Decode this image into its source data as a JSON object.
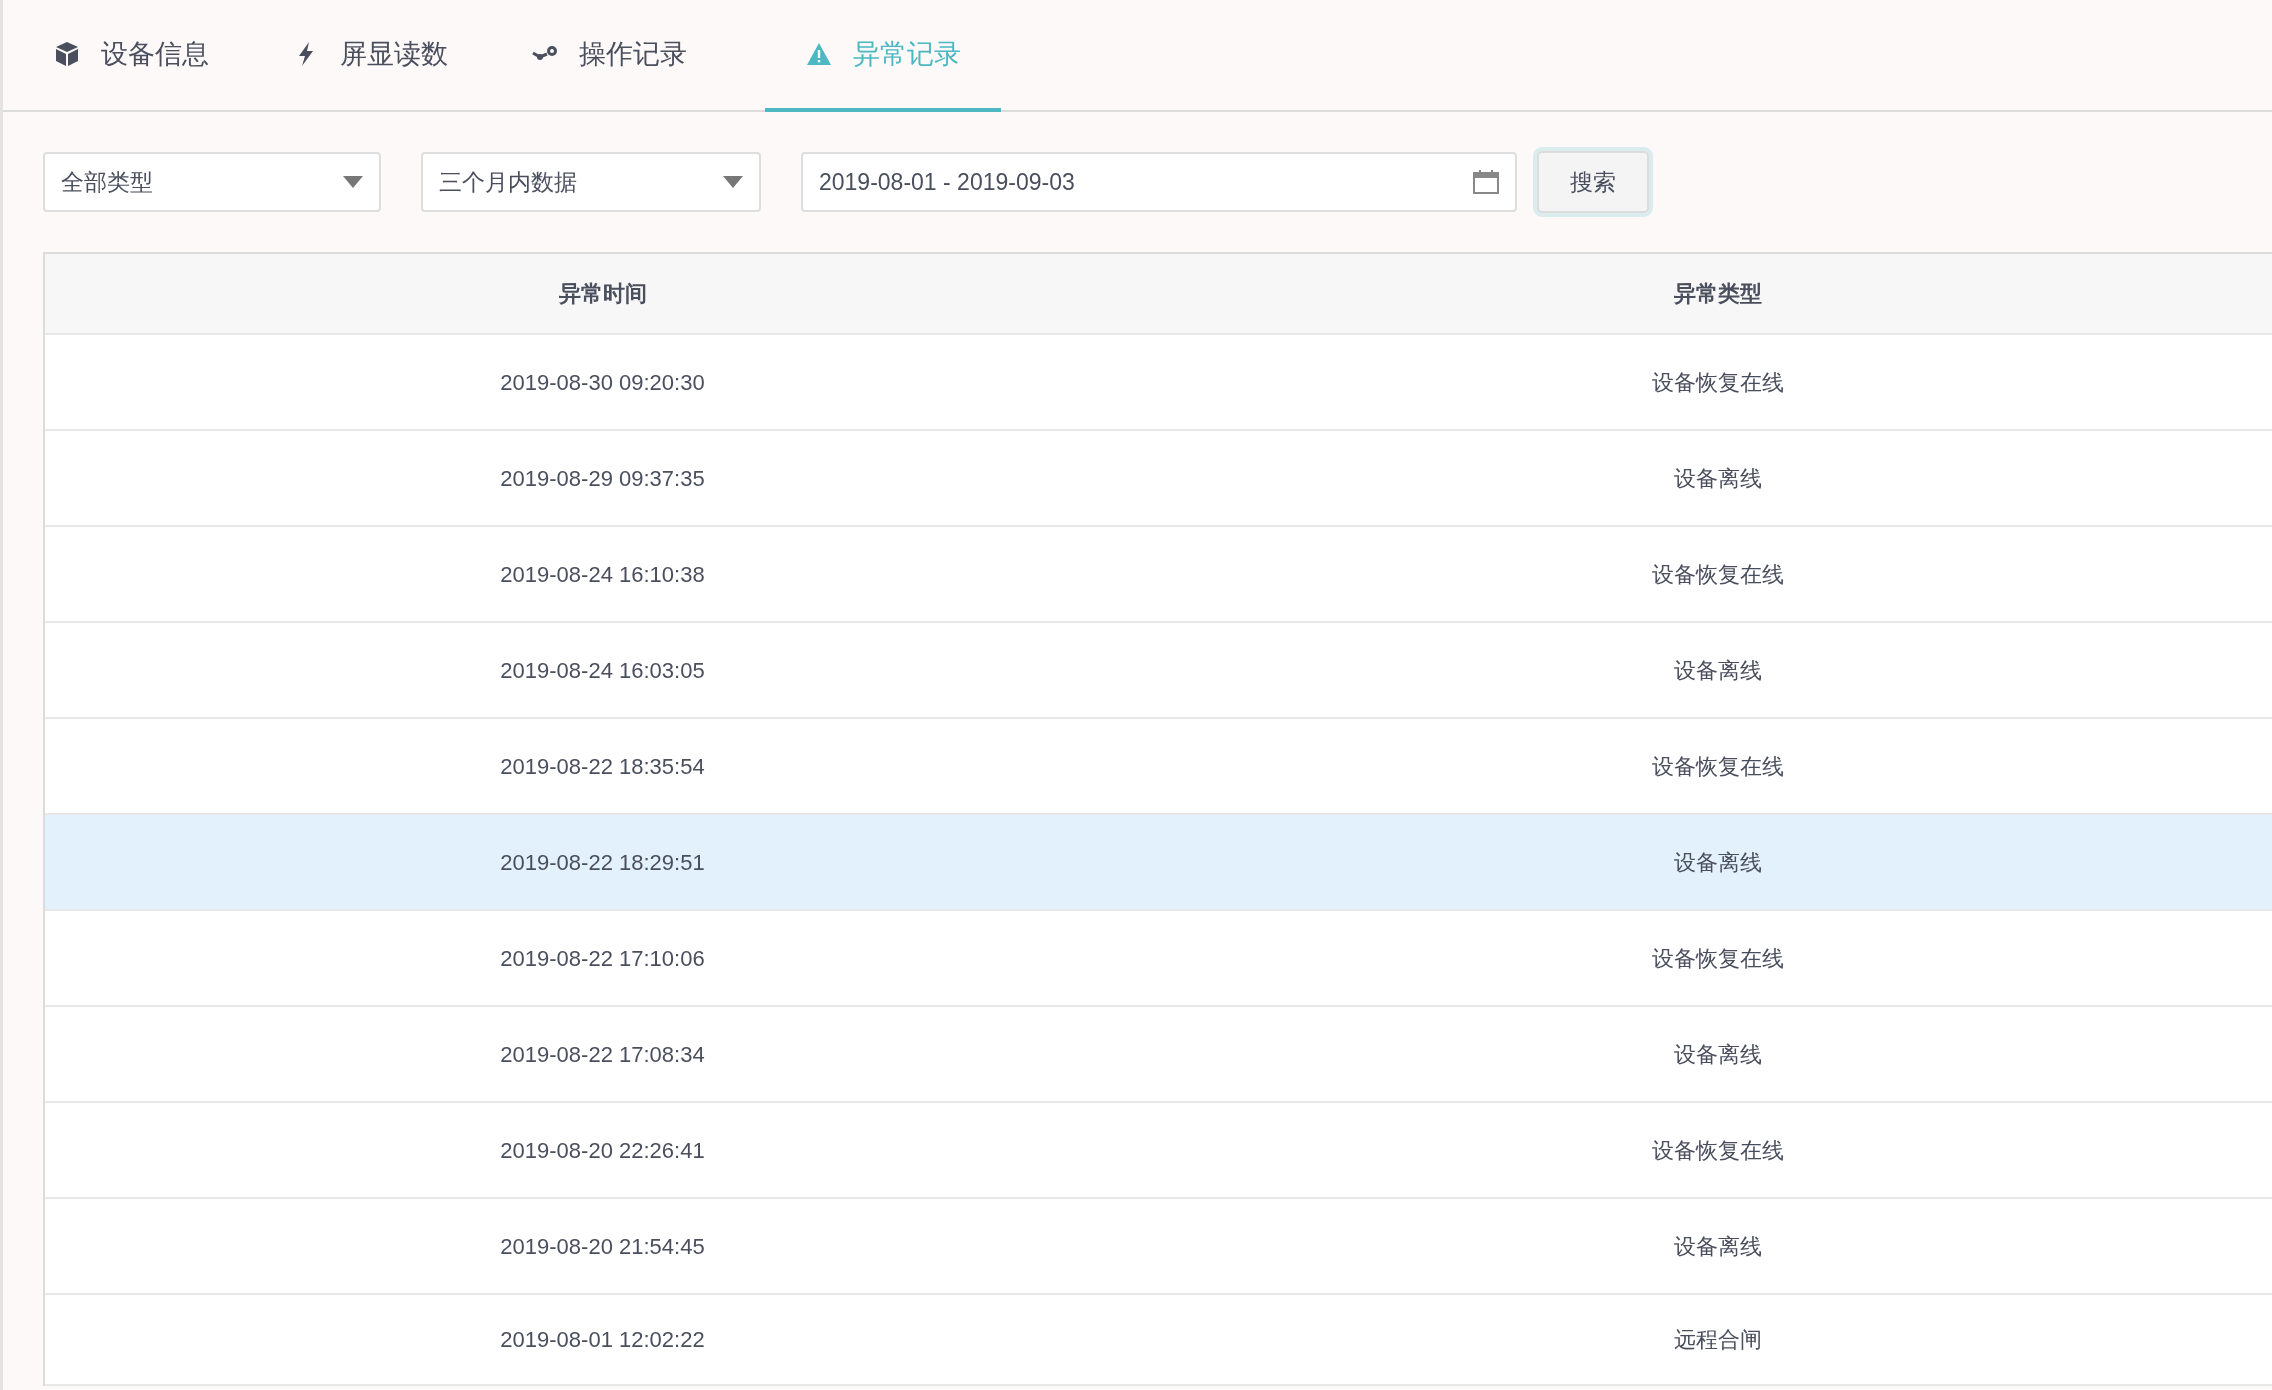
{
  "tabs": [
    {
      "label": "设备信息",
      "kind": "cube",
      "selected": false
    },
    {
      "label": "屏显读数",
      "kind": "bolt",
      "selected": false
    },
    {
      "label": "操作记录",
      "kind": "steam",
      "selected": false
    },
    {
      "label": "异常记录",
      "kind": "warning",
      "selected": true
    }
  ],
  "filters": {
    "type_select": {
      "value": "全部类型"
    },
    "range_select": {
      "value": "三个月内数据"
    },
    "date_range": {
      "value": "2019-08-01 - 2019-09-03"
    },
    "search_button": "搜索"
  },
  "table": {
    "columns": [
      "异常时间",
      "异常类型"
    ],
    "rows": [
      {
        "time": "2019-08-30 09:20:30",
        "type": "设备恢复在线",
        "highlighted": false
      },
      {
        "time": "2019-08-29 09:37:35",
        "type": "设备离线",
        "highlighted": false
      },
      {
        "time": "2019-08-24 16:10:38",
        "type": "设备恢复在线",
        "highlighted": false
      },
      {
        "time": "2019-08-24 16:03:05",
        "type": "设备离线",
        "highlighted": false
      },
      {
        "time": "2019-08-22 18:35:54",
        "type": "设备恢复在线",
        "highlighted": false
      },
      {
        "time": "2019-08-22 18:29:51",
        "type": "设备离线",
        "highlighted": true
      },
      {
        "time": "2019-08-22 17:10:06",
        "type": "设备恢复在线",
        "highlighted": false
      },
      {
        "time": "2019-08-22 17:08:34",
        "type": "设备离线",
        "highlighted": false
      },
      {
        "time": "2019-08-20 22:26:41",
        "type": "设备恢复在线",
        "highlighted": false
      },
      {
        "time": "2019-08-20 21:54:45",
        "type": "设备离线",
        "highlighted": false
      },
      {
        "time": "2019-08-01 12:02:22",
        "type": "远程合闸",
        "highlighted": false
      }
    ]
  }
}
